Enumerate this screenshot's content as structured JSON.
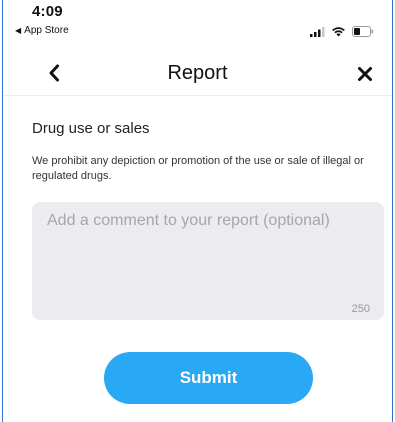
{
  "status_bar": {
    "time": "4:09",
    "back_app_label": "App Store"
  },
  "nav": {
    "title": "Report"
  },
  "report": {
    "reason_title": "Drug use or sales",
    "reason_description": "We prohibit any depiction or promotion of the use or sale of illegal or regulated drugs.",
    "comment_placeholder": "Add a comment to your report (optional)",
    "comment_value": "",
    "char_remaining": "250",
    "submit_label": "Submit"
  },
  "icons": {
    "back": "chevron-left-icon",
    "close": "close-icon",
    "signal": "signal-icon",
    "wifi": "wifi-icon",
    "battery": "battery-icon"
  },
  "colors": {
    "accent": "#29a8f5",
    "comment_bg": "#ececee",
    "frame_edge": "#2f6fd6"
  }
}
